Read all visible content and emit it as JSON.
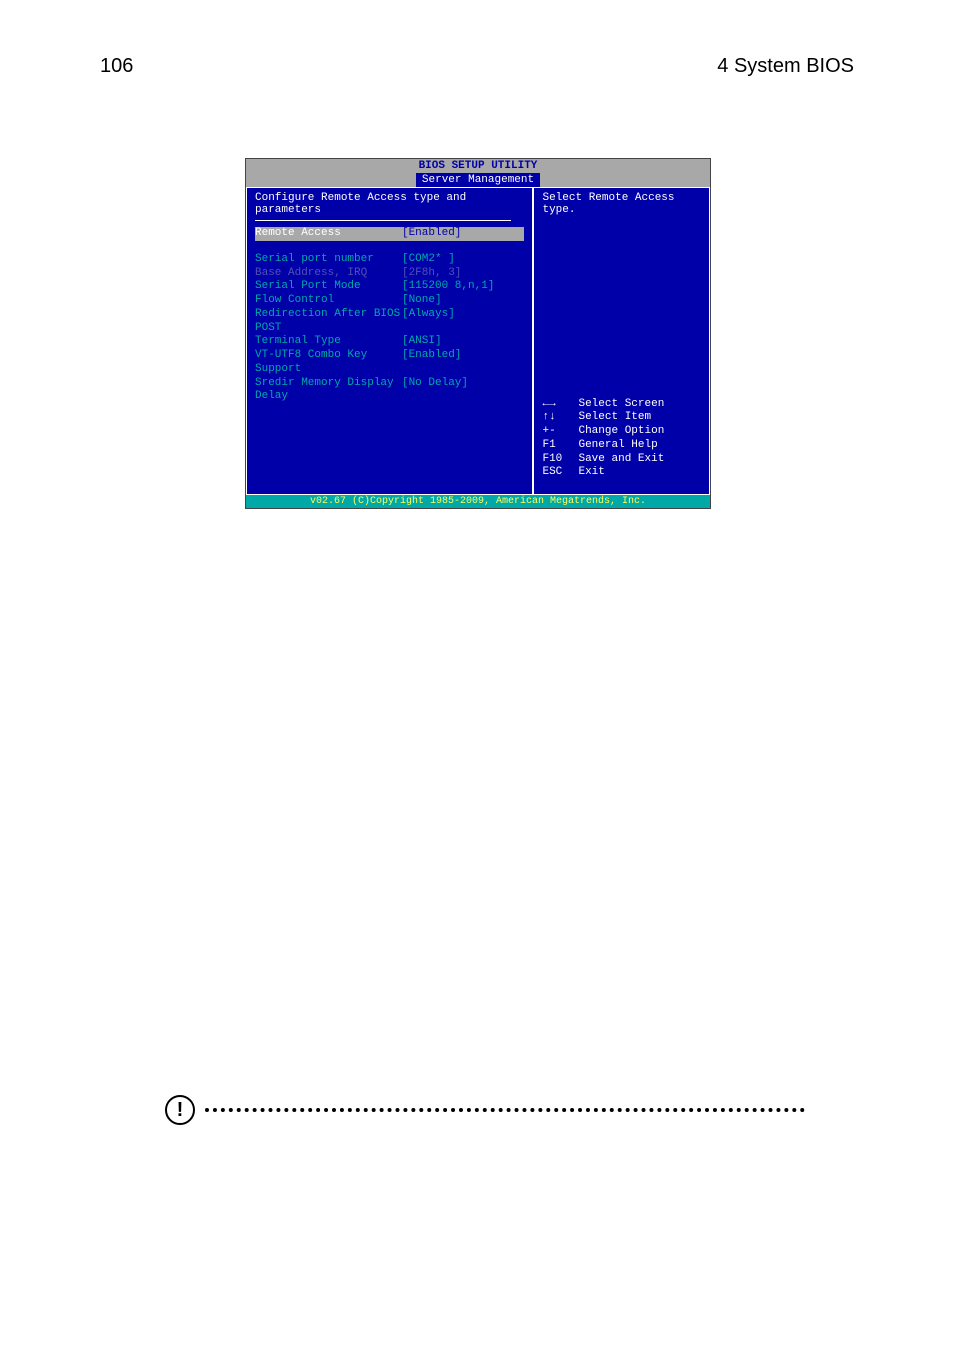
{
  "page": {
    "number": "106",
    "section": "4 System BIOS"
  },
  "bios": {
    "title": "BIOS SETUP UTILITY",
    "tab": "Server Management",
    "left": {
      "subtitle": "Configure Remote Access type and parameters",
      "rows": [
        {
          "label": "Remote Access",
          "value": "[Enabled]",
          "highlighted": true
        },
        {
          "label": "Serial port number",
          "value": "[COM2* ]",
          "cyan": true
        },
        {
          "label": "  Base Address, IRQ",
          "value": "[2F8h, 3]",
          "dimmed": true
        },
        {
          "label": "Serial Port Mode",
          "value": "[115200 8,n,1]",
          "cyan": true
        },
        {
          "label": "Flow Control",
          "value": "[None]",
          "cyan": true
        },
        {
          "label": "Redirection After BIOS POST",
          "value": "[Always]",
          "cyan": true
        },
        {
          "label": "Terminal Type",
          "value": "[ANSI]",
          "cyan": true
        },
        {
          "label": "VT-UTF8 Combo Key Support",
          "value": "[Enabled]",
          "cyan": true
        },
        {
          "label": "Sredir Memory Display Delay",
          "value": "[No Delay]",
          "cyan": true
        }
      ]
    },
    "right": {
      "help_text_1": "Select Remote Access",
      "help_text_2": "type.",
      "keys": [
        {
          "key": "←→",
          "desc": "Select Screen"
        },
        {
          "key": "↑↓",
          "desc": "Select Item"
        },
        {
          "key": "+-",
          "desc": "Change Option"
        },
        {
          "key": "F1",
          "desc": "General Help"
        },
        {
          "key": "F10",
          "desc": "Save and Exit"
        },
        {
          "key": "ESC",
          "desc": "Exit"
        }
      ]
    },
    "footer": "v02.67 (C)Copyright 1985-2009, American Megatrends, Inc."
  }
}
